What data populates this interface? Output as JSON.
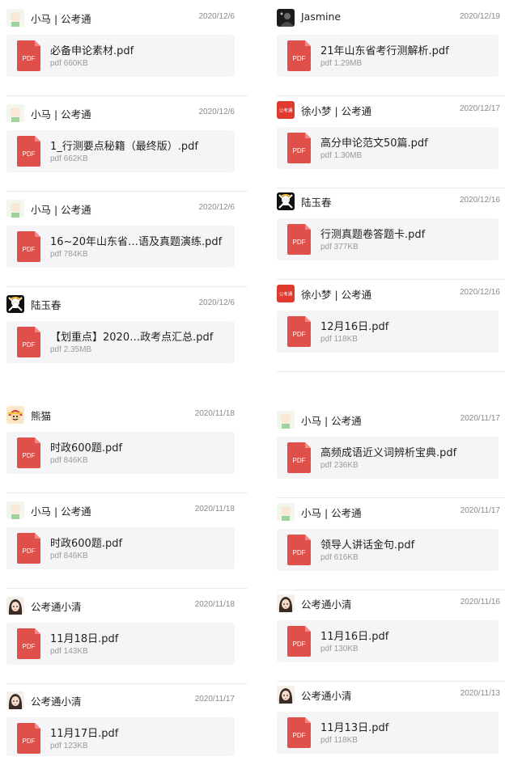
{
  "colors": {
    "pdf_red": "#e0504a",
    "card_bg": "#f5f5f7",
    "date_gray": "#8a8a8a"
  },
  "left": [
    {
      "sender": "小马 | 公考通",
      "date": "2020/12/6",
      "avatar": "xiaoma-avatar",
      "file": {
        "name": "必备申论素材.pdf",
        "size": "pdf 660KB",
        "icon": "PDF"
      }
    },
    {
      "sender": "小马 | 公考通",
      "date": "2020/12/6",
      "avatar": "xiaoma-avatar",
      "file": {
        "name": "1_行测要点秘籍（最终版）.pdf",
        "size": "pdf 662KB",
        "icon": "PDF"
      }
    },
    {
      "sender": "小马 | 公考通",
      "date": "2020/12/6",
      "avatar": "xiaoma-avatar",
      "file": {
        "name": "16~20年山东省…语及真题演练.pdf",
        "size": "pdf 784KB",
        "icon": "PDF"
      }
    },
    {
      "sender": "陆玉春",
      "date": "2020/12/6",
      "avatar": "skull-avatar",
      "file": {
        "name": "【划重点】2020…政考点汇总.pdf",
        "size": "pdf 2.35MB",
        "icon": "PDF"
      }
    },
    {
      "sender": "熊猫",
      "date": "2020/11/18",
      "avatar": "cartoon-avatar",
      "file": {
        "name": "时政600题.pdf",
        "size": "pdf 846KB",
        "icon": "PDF"
      }
    },
    {
      "sender": "小马 | 公考通",
      "date": "2020/11/18",
      "avatar": "xiaoma-avatar",
      "file": {
        "name": "时政600题.pdf",
        "size": "pdf 846KB",
        "icon": "PDF"
      }
    },
    {
      "sender": "公考通小清",
      "date": "2020/11/18",
      "avatar": "girl-avatar",
      "file": {
        "name": "11月18日.pdf",
        "size": "pdf 143KB",
        "icon": "PDF"
      }
    },
    {
      "sender": "公考通小清",
      "date": "2020/11/17",
      "avatar": "girl-avatar",
      "file": {
        "name": "11月17日.pdf",
        "size": "pdf 123KB",
        "icon": "PDF"
      }
    }
  ],
  "right": [
    {
      "sender": "Jasmine",
      "date": "2020/12/19",
      "avatar": "dark-photo-avatar",
      "file": {
        "name": "21年山东省考行测解析.pdf",
        "size": "pdf 1.29MB",
        "icon": "PDF"
      }
    },
    {
      "sender": "徐小梦 | 公考通",
      "date": "2020/12/17",
      "avatar": "gkt-logo-avatar",
      "avatar_text": "公考通",
      "file": {
        "name": "高分申论范文50篇.pdf",
        "size": "pdf 1.30MB",
        "icon": "PDF"
      }
    },
    {
      "sender": "陆玉春",
      "date": "2020/12/16",
      "avatar": "skull-avatar",
      "file": {
        "name": "行测真题卷答题卡.pdf",
        "size": "pdf 377KB",
        "icon": "PDF"
      }
    },
    {
      "sender": "徐小梦 | 公考通",
      "date": "2020/12/16",
      "avatar": "gkt-logo-avatar",
      "avatar_text": "公考通",
      "file": {
        "name": "12月16日.pdf",
        "size": "pdf 118KB",
        "icon": "PDF"
      }
    },
    {
      "sender": "小马 | 公考通",
      "date": "2020/11/17",
      "avatar": "xiaoma-avatar",
      "file": {
        "name": "高频成语近义词辨析宝典.pdf",
        "size": "pdf 236KB",
        "icon": "PDF"
      }
    },
    {
      "sender": "小马 | 公考通",
      "date": "2020/11/17",
      "avatar": "xiaoma-avatar",
      "file": {
        "name": "领导人讲话金句.pdf",
        "size": "pdf 616KB",
        "icon": "PDF"
      }
    },
    {
      "sender": "公考通小清",
      "date": "2020/11/16",
      "avatar": "girl-avatar",
      "file": {
        "name": "11月16日.pdf",
        "size": "pdf 130KB",
        "icon": "PDF"
      }
    },
    {
      "sender": "公考通小清",
      "date": "2020/11/13",
      "avatar": "girl-avatar",
      "file": {
        "name": "11月13日.pdf",
        "size": "pdf 118KB",
        "icon": "PDF"
      }
    }
  ]
}
